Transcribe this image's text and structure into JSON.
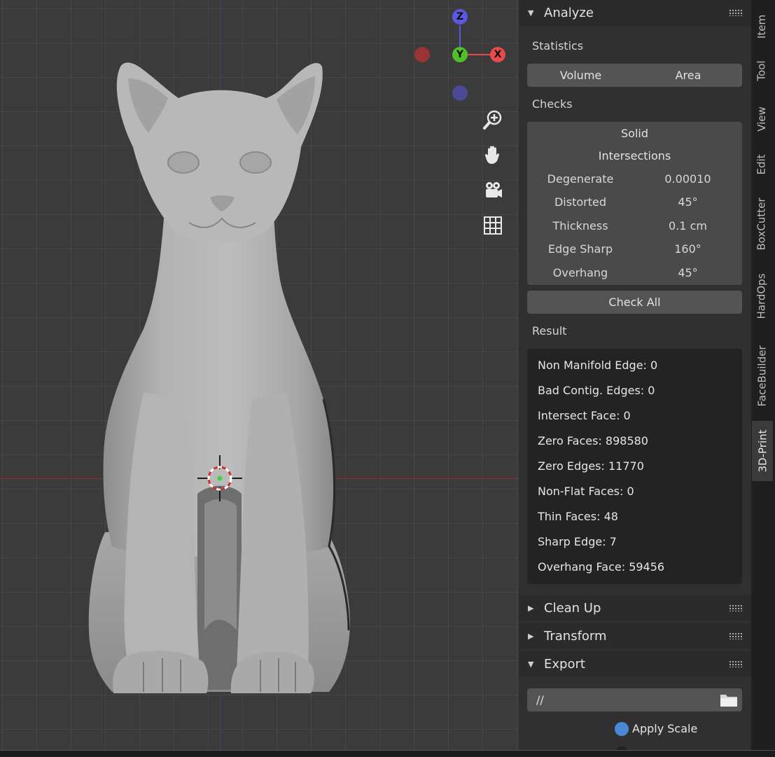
{
  "gizmo": {
    "z": "Z",
    "y": "Y",
    "x": "X"
  },
  "nav_icons": [
    "zoom-icon",
    "hand-pan-icon",
    "camera-icon",
    "grid-view-icon"
  ],
  "panels": {
    "analyze": {
      "title": "Analyze",
      "statistics_label": "Statistics",
      "volume_button": "Volume",
      "area_button": "Area",
      "checks_label": "Checks",
      "solid_button": "Solid",
      "intersections_button": "Intersections",
      "checks": [
        {
          "label": "Degenerate",
          "value": "0.00010"
        },
        {
          "label": "Distorted",
          "value": "45°"
        },
        {
          "label": "Thickness",
          "value": "0.1 cm"
        },
        {
          "label": "Edge Sharp",
          "value": "160°"
        },
        {
          "label": "Overhang",
          "value": "45°"
        }
      ],
      "check_all_button": "Check All",
      "result_label": "Result",
      "results": [
        "Non Manifold Edge: 0",
        "Bad Contig. Edges: 0",
        "Intersect Face: 0",
        "Zero Faces: 898580",
        "Zero Edges: 11770",
        "Non-Flat Faces: 0",
        "Thin Faces: 48",
        "Sharp Edge: 7",
        "Overhang Face: 59456"
      ]
    },
    "clean_up": {
      "title": "Clean Up"
    },
    "transform": {
      "title": "Transform"
    },
    "export": {
      "title": "Export",
      "path_value": "//",
      "apply_scale_label": "Apply Scale"
    }
  },
  "tabs": [
    "Item",
    "Tool",
    "View",
    "Edit",
    "BoxCutter",
    "HardOps",
    "FaceBuilder",
    "3D-Print"
  ],
  "active_tab": "3D-Print",
  "colors": {
    "gizmo_z": "#5a5ae0",
    "gizmo_y": "#4fbf2a",
    "gizmo_x": "#e84a4a",
    "accent_blue": "#4a88d8"
  }
}
